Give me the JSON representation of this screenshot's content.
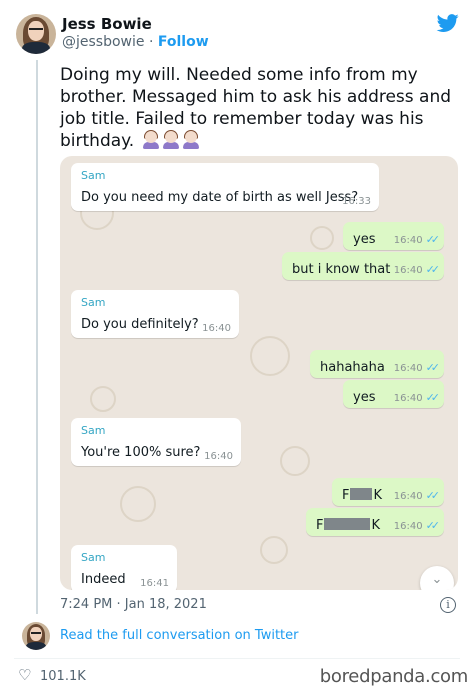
{
  "author": {
    "name": "Jess Bowie",
    "handle": "@jessbowie",
    "separator": "·",
    "follow_label": "Follow"
  },
  "tweet": {
    "text": "Doing my will. Needed some info from my brother. Messaged him to ask his address and job title. Failed to remember today was his birthday.",
    "emoji_count": 3,
    "timestamp": "7:24 PM · Jan 18, 2021",
    "read_full_label": "Read the full conversation on Twitter",
    "likes": "101.1K"
  },
  "chat": {
    "messages": [
      {
        "dir": "in",
        "sender": "Sam",
        "text": "Do you need my date of birth as well Jess?",
        "time": "16:33"
      },
      {
        "dir": "out",
        "text": "yes",
        "time": "16:40"
      },
      {
        "dir": "out",
        "text": "but i know that",
        "time": "16:40"
      },
      {
        "dir": "in",
        "sender": "Sam",
        "text": "Do you definitely?",
        "time": "16:40"
      },
      {
        "dir": "out",
        "text": "hahahaha",
        "time": "16:40"
      },
      {
        "dir": "out",
        "text": "yes",
        "time": "16:40"
      },
      {
        "dir": "in",
        "sender": "Sam",
        "text": "You're 100% sure?",
        "time": "16:40"
      },
      {
        "dir": "out",
        "text_start": "F",
        "text_end": "K",
        "censored": true,
        "time": "16:40"
      },
      {
        "dir": "out",
        "text_start": "F",
        "text_end": "K",
        "censored": true,
        "time": "16:40"
      },
      {
        "dir": "in",
        "sender": "Sam",
        "text": "Indeed",
        "time": "16:41"
      }
    ]
  },
  "icons": {
    "twitter": "twitter-bird-icon",
    "info": "info-icon",
    "like": "heart-icon",
    "scroll_down": "chevron-down-icon",
    "read_receipt": "double-check-icon"
  },
  "colors": {
    "twitter_blue": "#1d9bf0",
    "chat_background": "#ece5dd",
    "outgoing_bubble": "#dcf8c6",
    "sender_name": "#35a6c4",
    "read_ticks": "#4fb6ec"
  },
  "watermark": "boredpanda.com"
}
